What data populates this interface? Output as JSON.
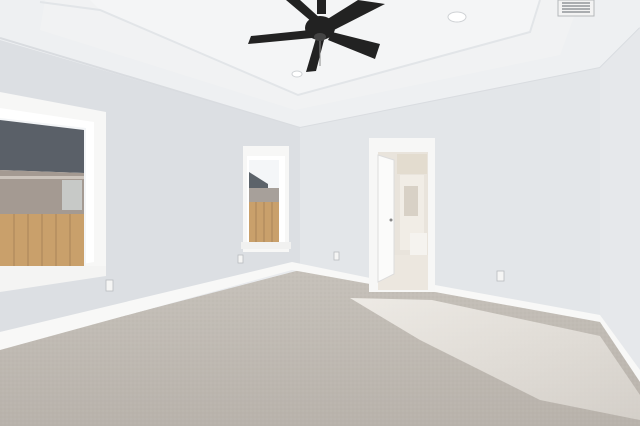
{
  "scene": {
    "subject": "empty-bedroom",
    "colors": {
      "wall": "#dfe2e6",
      "wall_shadow": "#d3d7dc",
      "ceiling": "#f2f3f4",
      "tray": "#eceef0",
      "trim": "#f7f7f6",
      "carpet": "#bfb9b2",
      "carpet_light": "#dcd8d2",
      "fan": "#222222",
      "fence": "#c9a06b",
      "sky": "#f4f6f8"
    }
  }
}
